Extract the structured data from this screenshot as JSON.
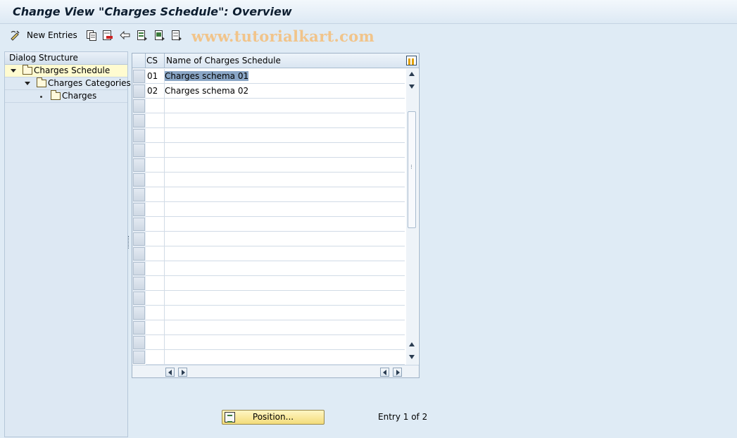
{
  "window": {
    "title": "Change View \"Charges Schedule\": Overview",
    "watermark": "www.tutorialkart.com"
  },
  "toolbar": {
    "new_entries_label": "New Entries",
    "icons": [
      "display-change-icon",
      "copy-icon",
      "delete-icon",
      "undo-change-icon",
      "select-all-icon",
      "select-block-icon",
      "deselect-all-icon"
    ]
  },
  "dialog_structure": {
    "title": "Dialog Structure",
    "items": [
      {
        "label": "Charges Schedule",
        "expanded": true,
        "selected": true
      },
      {
        "label": "Charges Categories",
        "expanded": true,
        "selected": false
      },
      {
        "label": "Charges",
        "expanded": false,
        "selected": false
      }
    ]
  },
  "table": {
    "columns": [
      "CS",
      "Name of Charges Schedule"
    ],
    "rows": [
      {
        "cs": "01",
        "name": "Charges schema 01"
      },
      {
        "cs": "02",
        "name": "Charges schema 02"
      }
    ]
  },
  "footer": {
    "position_button_label": "Position...",
    "entry_info": "Entry 1 of 2"
  },
  "colors": {
    "background": "#dfebf5",
    "selected_tree_row": "#fffbd0",
    "position_button": "#f3dc7a",
    "watermark": "#f1c48a"
  }
}
